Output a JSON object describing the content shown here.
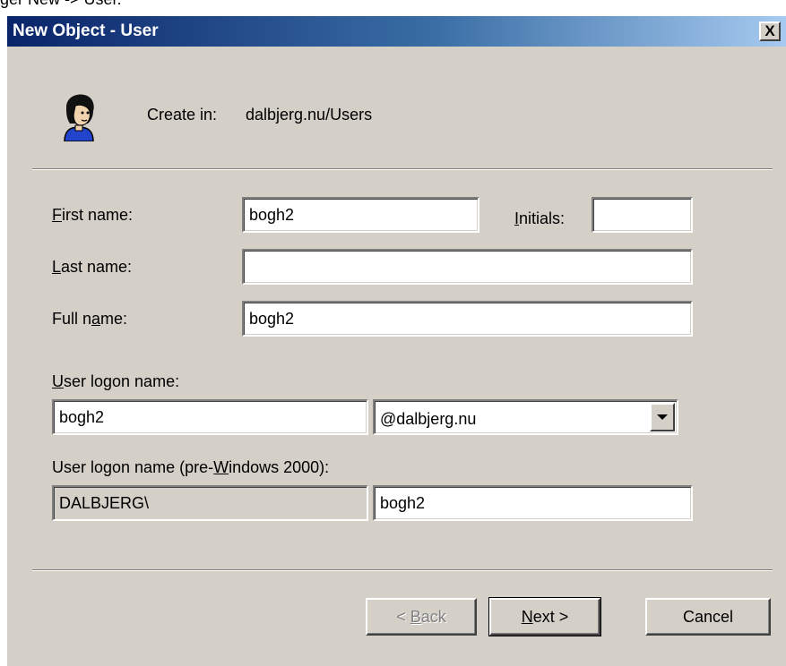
{
  "top_crop_text": "ger New -> User.",
  "window": {
    "title": "New Object - User",
    "close_label": "X"
  },
  "header": {
    "create_in_label": "Create in:",
    "create_in_value": "dalbjerg.nu/Users",
    "icon": "user-icon"
  },
  "form": {
    "first_name": {
      "mn": "F",
      "rest": "irst name:",
      "value": "bogh2"
    },
    "initials": {
      "mn": "I",
      "rest": "nitials:",
      "value": ""
    },
    "last_name": {
      "mn": "L",
      "rest": "ast name:",
      "value": ""
    },
    "full_name": {
      "pre": "Full n",
      "mn": "a",
      "post": "me:",
      "value": "bogh2"
    },
    "logon_name": {
      "mn": "U",
      "rest": "ser logon name:",
      "value": "bogh2",
      "domain": "@dalbjerg.nu"
    },
    "pre2000": {
      "pre": "User logon name (pre-",
      "mn": "W",
      "post": "indows 2000):",
      "domain": "DALBJERG\\",
      "value": "bogh2"
    }
  },
  "buttons": {
    "back": {
      "pre": "< ",
      "mn": "B",
      "post": "ack"
    },
    "next": {
      "mn": "N",
      "post": "ext >"
    },
    "cancel": "Cancel"
  }
}
